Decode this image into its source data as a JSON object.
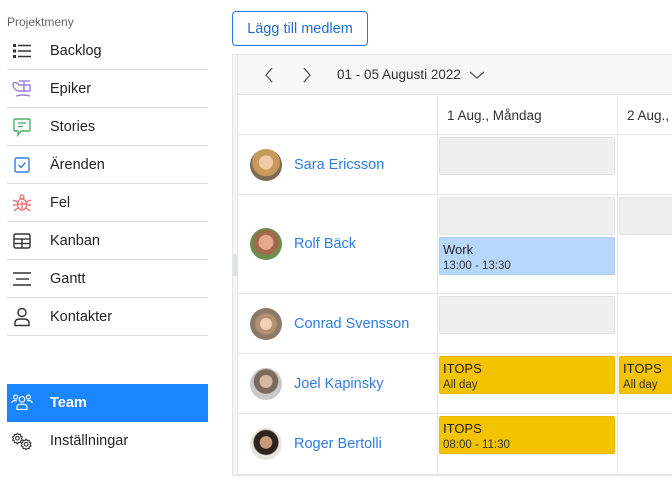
{
  "sidebar": {
    "heading": "Projektmeny",
    "items": [
      {
        "label": "Backlog",
        "icon": "list-icon",
        "color": "#333333"
      },
      {
        "label": "Epiker",
        "icon": "epic-icon",
        "color": "#9b7ee0"
      },
      {
        "label": "Stories",
        "icon": "story-chat-icon",
        "color": "#4caf6a"
      },
      {
        "label": "Ärenden",
        "icon": "checkbox-icon",
        "color": "#2f7de1"
      },
      {
        "label": "Fel",
        "icon": "bug-icon",
        "color": "#f06a6a"
      },
      {
        "label": "Kanban",
        "icon": "board-icon",
        "color": "#333333"
      },
      {
        "label": "Gantt",
        "icon": "gantt-icon",
        "color": "#333333"
      },
      {
        "label": "Kontakter",
        "icon": "user-icon",
        "color": "#333333"
      }
    ],
    "bottom_items": [
      {
        "label": "Team",
        "icon": "team-icon",
        "active": true
      },
      {
        "label": "Inställningar",
        "icon": "gears-icon",
        "active": false
      }
    ],
    "active_color": "#1a85ff"
  },
  "toolbar": {
    "add_member_label": "Lägg till medlem"
  },
  "scheduler": {
    "date_range": "01 - 05 Augusti 2022",
    "columns": [
      "1 Aug., Måndag",
      "2 Aug.,"
    ],
    "resources": [
      {
        "name": "Sara Ericsson",
        "events": [
          {
            "day": 0,
            "type": "busy",
            "title": "",
            "time": ""
          }
        ]
      },
      {
        "name": "Rolf Bäck",
        "events": [
          {
            "day": 0,
            "type": "busy",
            "title": "",
            "time": ""
          },
          {
            "day": 1,
            "type": "busy",
            "title": "",
            "time": ""
          },
          {
            "day": 0,
            "type": "work",
            "title": "Work",
            "time": "13:00 - 13:30"
          }
        ]
      },
      {
        "name": "Conrad Svensson",
        "events": [
          {
            "day": 0,
            "type": "busy",
            "title": "",
            "time": ""
          }
        ]
      },
      {
        "name": "Joel Kapinsky",
        "events": [
          {
            "day": 0,
            "type": "itops",
            "title": "ITOPS",
            "time": "All day"
          },
          {
            "day": 1,
            "type": "itops",
            "title": "ITOPS",
            "time": "All day"
          }
        ]
      },
      {
        "name": "Roger Bertolli",
        "events": [
          {
            "day": 0,
            "type": "itops",
            "title": "ITOPS",
            "time": "08:00 - 11:30"
          }
        ]
      }
    ],
    "event_colors": {
      "busy": "#efefef",
      "work": "#b8d8fb",
      "itops": "#f3c300"
    }
  }
}
